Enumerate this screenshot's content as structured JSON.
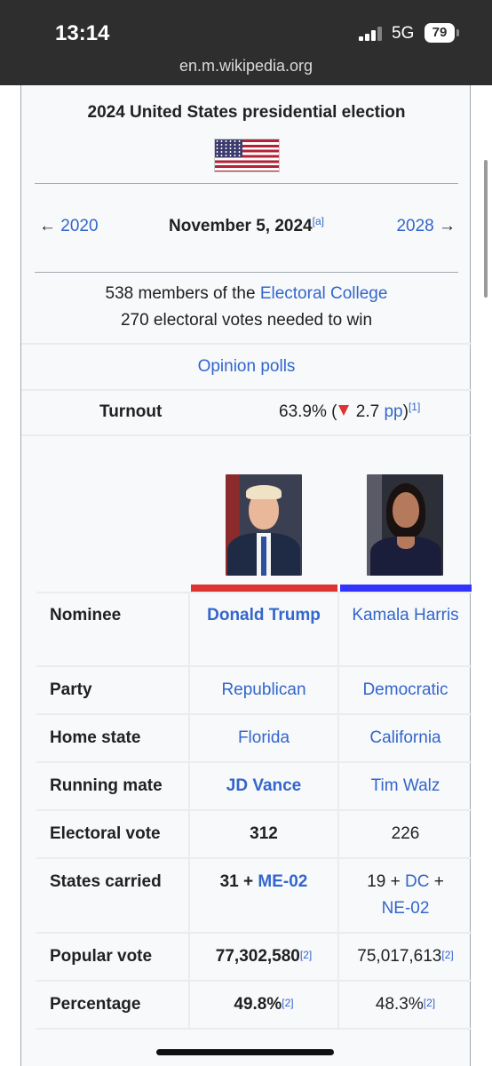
{
  "status": {
    "time": "13:14",
    "network": "5G",
    "battery": "79",
    "url": "en.m.wikipedia.org"
  },
  "infobox": {
    "title": "2024 United States presidential election",
    "prev": "2020",
    "prev_arrow": "←",
    "date": "November 5, 2024",
    "date_note": "[a]",
    "next": "2028",
    "next_arrow": "→",
    "electoral_prefix": "538 members of the ",
    "electoral_link": "Electoral College",
    "needed": "270 electoral votes needed to win",
    "polls": "Opinion polls",
    "turnout_label": "Turnout",
    "turnout_value": "63.9% (",
    "turnout_change": "2.7",
    "turnout_unit": "pp",
    "turnout_close": ")",
    "turnout_ref": "[1]"
  },
  "candidates": {
    "colors": {
      "republican": "#dd3333",
      "democratic": "#3333ff"
    },
    "rows": {
      "nominee": {
        "label": "Nominee",
        "c1": "Donald Trump",
        "c2": "Kamala Harris"
      },
      "party": {
        "label": "Party",
        "c1": "Republican",
        "c2": "Democratic"
      },
      "home": {
        "label": "Home state",
        "c1": "Florida",
        "c2": "California"
      },
      "mate": {
        "label": "Running mate",
        "c1": "JD Vance",
        "c2": "Tim Walz"
      },
      "electoral": {
        "label": "Electoral vote",
        "c1": "312",
        "c2": "226"
      },
      "states": {
        "label": "States carried",
        "c1_num": "31 + ",
        "c1_link": "ME-02",
        "c2_num": "19 + ",
        "c2_link1": "DC",
        "c2_plus": " +",
        "c2_link2": "NE-02"
      },
      "popular": {
        "label": "Popular vote",
        "c1": "77,302,580",
        "c1_ref": "[2]",
        "c2": "75,017,613",
        "c2_ref": "[2]"
      },
      "percentage": {
        "label": "Percentage",
        "c1": "49.8%",
        "c1_ref": "[2]",
        "c2": "48.3%",
        "c2_ref": "[2]"
      }
    }
  }
}
